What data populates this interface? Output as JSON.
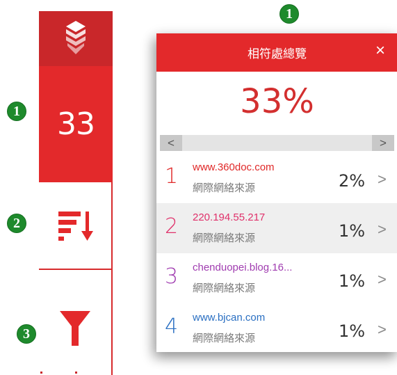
{
  "badges": [
    "1",
    "1",
    "2",
    "3"
  ],
  "sidebar": {
    "score": "33",
    "logo_icon": "shield-stack-icon",
    "sort_icon": "sort-desc-icon",
    "filter_icon": "filter-icon"
  },
  "panel": {
    "title": "相符處總覽",
    "close": "×",
    "percent": "33%",
    "scroll_left": "<",
    "scroll_right": ">",
    "rows": [
      {
        "num": "1",
        "url": "www.360doc.com",
        "source": "網際網絡來源",
        "pct": "2%",
        "chevron": ">",
        "color": "#e02828"
      },
      {
        "num": "2",
        "url": "220.194.55.217",
        "source": "網際網絡來源",
        "pct": "1%",
        "chevron": ">",
        "color": "#e0306a"
      },
      {
        "num": "3",
        "url": "chenduopei.blog.16...",
        "source": "網際網絡來源",
        "pct": "1%",
        "chevron": ">",
        "color": "#a03cb0"
      },
      {
        "num": "4",
        "url": "www.bjcan.com",
        "source": "網際網絡來源",
        "pct": "1%",
        "chevron": ">",
        "color": "#2a6fc2"
      }
    ]
  },
  "colors": {
    "brand_red": "#e3292b",
    "dark_red": "#c9272a",
    "badge_green": "#1e8a2c"
  }
}
